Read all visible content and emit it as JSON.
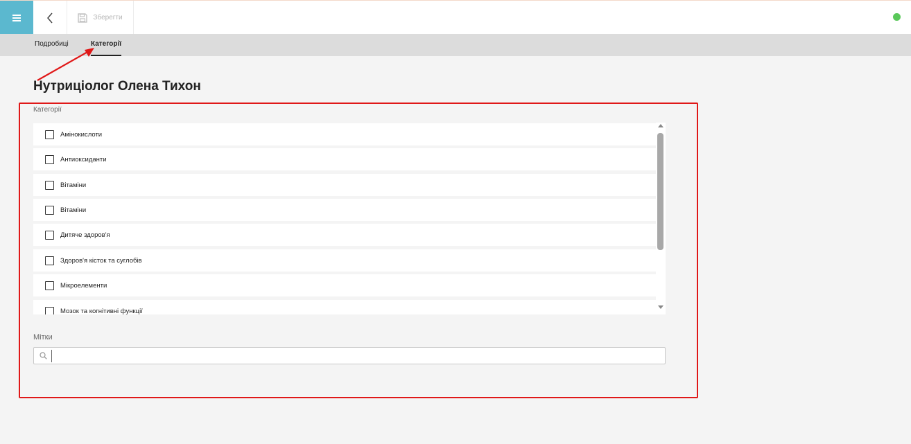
{
  "toolbar": {
    "menu_icon": "hamburger-menu-icon",
    "back_icon": "chevron-left-icon",
    "save_icon": "floppy-disk-icon",
    "save_label": "Зберегти",
    "status_color": "#5ac85a"
  },
  "tabs": [
    {
      "label": "Подробиці"
    },
    {
      "label": "Категорії"
    }
  ],
  "title": "Нутриціолог Олена Тихон",
  "categories_section": {
    "label": "Категорії",
    "items": [
      {
        "label": "Амінокислоти"
      },
      {
        "label": "Антиоксиданти"
      },
      {
        "label": "Вітаміни"
      },
      {
        "label": "Вітаміни"
      },
      {
        "label": "Дитяче здоров'я"
      },
      {
        "label": "Здоров'я кісток та суглобів"
      },
      {
        "label": "Мікроелементи"
      },
      {
        "label": "Мозок та когнітивні функції"
      }
    ]
  },
  "tags_section": {
    "label": "Мітки",
    "search_icon": "search-icon",
    "value": "",
    "placeholder": ""
  },
  "colors": {
    "accent": "#5bb8cf",
    "highlight": "#e01818"
  }
}
